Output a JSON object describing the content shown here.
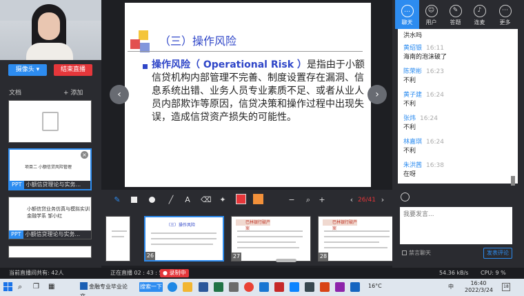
{
  "left": {
    "camera_button": "摄像头 ▾",
    "end_button": "结束直播",
    "docs_label": "文档",
    "add_label": "添加",
    "docs": [
      {
        "tag": "",
        "title": ""
      },
      {
        "tag": "PPT",
        "title": "小额信贷理论与实务...",
        "slide_title": "项目二 小额信贷风险管理"
      },
      {
        "tag": "PPT",
        "title": "小额信贷理论与实务...",
        "slide_title": "小额信贷业务仿真与模拟实训",
        "slide_sub": "金融学系 邹小红"
      }
    ]
  },
  "slide": {
    "title": "（三）操作风险",
    "term": "操作风险（ Operational Risk ）",
    "body": "是指由于小额信贷机构内部管理不完善、制度设置存在漏洞、信息系统出错、业务人员专业素质不足、或者从业人员内部欺诈等原因，信贷决策和操作过程中出现失误，造成信贷资产损失的可能性。"
  },
  "toolbar": {
    "page_current": "26",
    "page_total": "/41",
    "colors": {
      "red": "#e6363a",
      "orange": "#f3913a"
    }
  },
  "thumbnails": [
    {
      "num": "",
      "title": ""
    },
    {
      "num": "26",
      "title": "（三）操作风险"
    },
    {
      "num": "27",
      "title": "巴林银行破产案"
    },
    {
      "num": "28",
      "title": "巴林银行破产案"
    }
  ],
  "tabs": [
    {
      "label": "聊天",
      "icon": "chat-icon"
    },
    {
      "label": "用户",
      "icon": "users-icon"
    },
    {
      "label": "答题",
      "icon": "edit-icon"
    },
    {
      "label": "连麦",
      "icon": "mic-icon"
    },
    {
      "label": "更多",
      "icon": "more-icon"
    }
  ],
  "chat": {
    "messages": [
      {
        "name": "",
        "time": "",
        "text": "洪水吗"
      },
      {
        "name": "黄绍银",
        "time": "16:11",
        "text": "海南的泡沫破了"
      },
      {
        "name": "陈荣彬",
        "time": "16:23",
        "text": "不利"
      },
      {
        "name": "黄子建",
        "time": "16:24",
        "text": "不利"
      },
      {
        "name": "张炜",
        "time": "16:24",
        "text": "不利"
      },
      {
        "name": "林嘉琪",
        "time": "16:24",
        "text": "不利"
      },
      {
        "name": "朱洪茜",
        "time": "16:38",
        "text": "在呀"
      }
    ],
    "input_placeholder": "我要发言...",
    "mute_label": "禁言聊天",
    "send_label": "发表评论"
  },
  "status": {
    "online": "当前直播间共有: 42人",
    "live_time": "正在直播 02 : 43 : 57",
    "recording": "● 录制中",
    "speed": "54.36 kB/s",
    "cpu": "CPU: 9 %"
  },
  "taskbar": {
    "doc_window": "金融专业毕业论文...",
    "search_btn": "搜索一下",
    "temperature": "16°C",
    "input_method": "中",
    "time": "16:40",
    "date": "2022/3/24",
    "notifications": "18"
  }
}
